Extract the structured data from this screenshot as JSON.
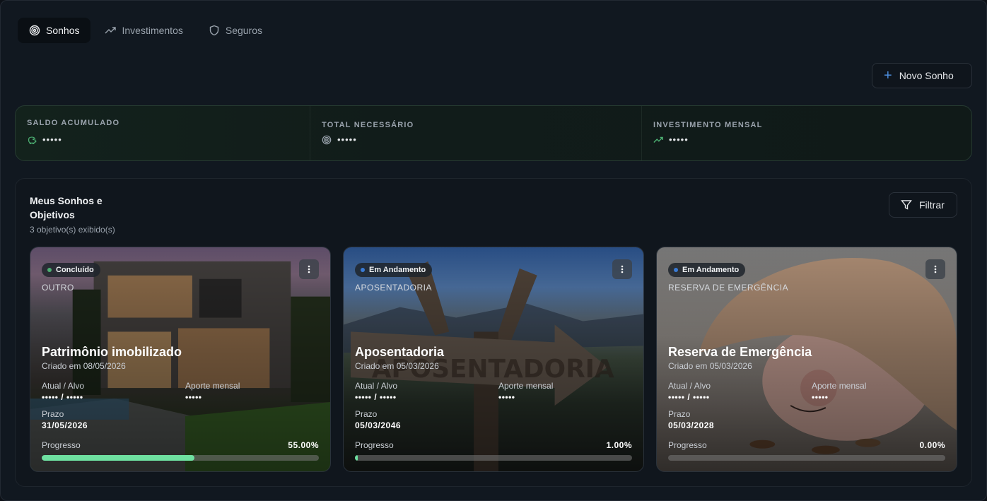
{
  "tabs": [
    {
      "label": "Sonhos",
      "icon": "target-icon"
    },
    {
      "label": "Investimentos",
      "icon": "trending-up-icon"
    },
    {
      "label": "Seguros",
      "icon": "shield-icon"
    }
  ],
  "actions": {
    "new_dream": "Novo Sonho",
    "filter": "Filtrar"
  },
  "summary": [
    {
      "label": "SALDO ACUMULADO",
      "value": "•••••",
      "icon": "piggy-bank-icon"
    },
    {
      "label": "TOTAL NECESSÁRIO",
      "value": "•••••",
      "icon": "target-icon"
    },
    {
      "label": "INVESTIMENTO MENSAL",
      "value": "•••••",
      "icon": "trending-up-icon"
    }
  ],
  "panel": {
    "title": "Meus Sonhos e Objetivos",
    "subtitle": "3 objetivo(s) exibido(s)"
  },
  "labels": {
    "atual_alvo": "Atual / Alvo",
    "aporte": "Aporte mensal",
    "prazo": "Prazo",
    "progresso": "Progresso"
  },
  "cards": [
    {
      "status": "Concluído",
      "status_color": "#4caf72",
      "category": "OUTRO",
      "name": "Patrimônio imobilizado",
      "created": "Criado em 08/05/2026",
      "atual_alvo": "••••• / •••••",
      "aporte": "•••••",
      "prazo": "31/05/2026",
      "progress_label": "55.00%",
      "progress": 0.55
    },
    {
      "status": "Em Andamento",
      "status_color": "#3a7bd5",
      "category": "APOSENTADORIA",
      "name": "Aposentadoria",
      "created": "Criado em 05/03/2026",
      "atual_alvo": "••••• / •••••",
      "aporte": "•••••",
      "prazo": "05/03/2046",
      "progress_label": "1.00%",
      "progress": 0.01
    },
    {
      "status": "Em Andamento",
      "status_color": "#3a7bd5",
      "category": "RESERVA DE EMERGÊNCIA",
      "name": "Reserva de Emergência",
      "created": "Criado em 05/03/2026",
      "atual_alvo": "••••• / •••••",
      "aporte": "•••••",
      "prazo": "05/03/2028",
      "progress_label": "0.00%",
      "progress": 0.0
    }
  ]
}
